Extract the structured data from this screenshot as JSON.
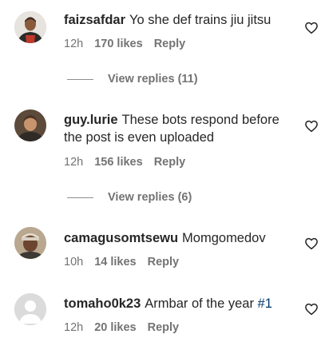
{
  "comments": [
    {
      "username": "faizsafdar",
      "text": "Yo she def trains jiu jitsu",
      "time": "12h",
      "likes": "170 likes",
      "reply": "Reply",
      "view_replies": "View replies (11)"
    },
    {
      "username": "guy.lurie",
      "text": "These bots respond before the post is even uploaded",
      "time": "12h",
      "likes": "156 likes",
      "reply": "Reply",
      "view_replies": "View replies (6)"
    },
    {
      "username": "camagusomtsewu",
      "text": "Momgomedov",
      "time": "10h",
      "likes": "14 likes",
      "reply": "Reply"
    },
    {
      "username": "tomaho0k23",
      "text": "Armbar of the year ",
      "hashtag": "#1",
      "time": "12h",
      "likes": "20 likes",
      "reply": "Reply"
    }
  ],
  "icons": {
    "heart": "heart-outline-icon",
    "avatar_placeholder": "default-avatar-icon"
  }
}
